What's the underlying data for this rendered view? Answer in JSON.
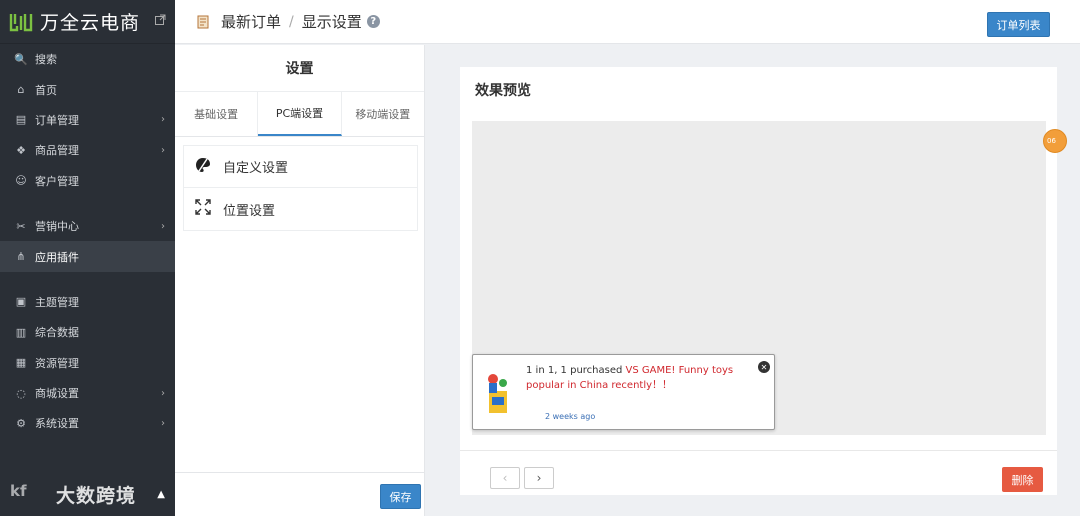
{
  "brand": {
    "name": "万全云电商",
    "logo": "logo-icon",
    "external": "external-link-icon"
  },
  "sidebar": {
    "items": [
      {
        "label": "搜索",
        "icon": "🔍"
      },
      {
        "label": "首页",
        "icon": "⌂"
      },
      {
        "label": "订单管理",
        "icon": "▤",
        "arrow": "›"
      },
      {
        "label": "商品管理",
        "icon": "❖",
        "arrow": "›"
      },
      {
        "label": "客户管理",
        "icon": "☺"
      },
      {
        "label": "营销中心",
        "icon": "✂",
        "arrow": "›"
      },
      {
        "label": "应用插件",
        "icon": "⋔"
      },
      {
        "label": "主题管理",
        "icon": "▣"
      },
      {
        "label": "综合数据",
        "icon": "▥"
      },
      {
        "label": "资源管理",
        "icon": "▦"
      },
      {
        "label": "商城设置",
        "icon": "◌",
        "arrow": "›"
      },
      {
        "label": "系统设置",
        "icon": "⚙",
        "arrow": "›"
      }
    ],
    "watermark": "大数跨境",
    "watermark_logo": "kf"
  },
  "header": {
    "breadcrumb_1": "最新订单",
    "separator": "/",
    "breadcrumb_2": "显示设置",
    "help": "?",
    "order_list_button": "订单列表"
  },
  "settings": {
    "title": "设置",
    "tabs": [
      "基础设置",
      "PC端设置",
      "移动端设置"
    ],
    "items": [
      {
        "label": "自定义设置",
        "icon": "palette-icon"
      },
      {
        "label": "位置设置",
        "icon": "expand-icon"
      }
    ],
    "save_button": "保存"
  },
  "preview": {
    "title": "效果预览",
    "popup": {
      "message_prefix": "1 in 1, 1 purchased ",
      "message_highlight": "VS GAME! Funny toys popular in China recently！！",
      "time": "2 weeks ago",
      "close": "✕"
    },
    "prev": "‹",
    "next": "›",
    "delete_button": "删除"
  },
  "float_badge": "06"
}
